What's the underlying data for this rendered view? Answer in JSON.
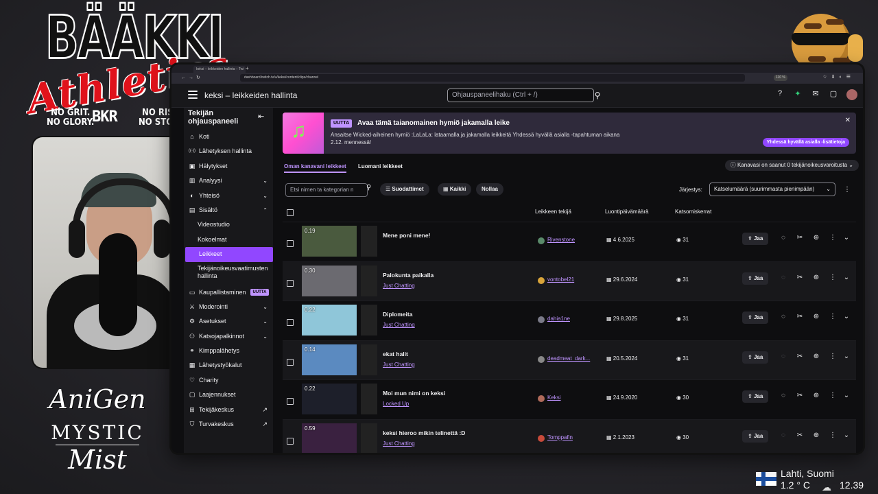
{
  "overlay": {
    "logo_main": "BÄÄKKI",
    "logo_script": "Athletics",
    "logo_tag_left": "NO GRIT.\nNO GLORY.",
    "logo_tag_right": "NO RISK.\nNO STORY.",
    "logo_mono": "BKR",
    "anigen_1": "AniGen",
    "anigen_2": "MYSTIC",
    "anigen_3": "Mist",
    "weather_city": "Lahti, Suomi",
    "weather_temp": "1.2 ° C",
    "clock": "12.39"
  },
  "browser": {
    "tab_title": "keksi – leikkeiden hallinta – Twi",
    "url": "dashboard.twitch.tv/u/keksi/content/clips/channel",
    "zoom": "110 %"
  },
  "topnav": {
    "title": "keksi – leikkeiden hallinta",
    "search_placeholder": "Ohjauspaneelihaku (Ctrl + /)"
  },
  "sidebar": {
    "heading": "Tekijän ohjauspaneeli",
    "items": [
      {
        "label": "Koti",
        "icon": "⌂"
      },
      {
        "label": "Lähetyksen hallinta",
        "icon": "((·))"
      },
      {
        "label": "Hälytykset",
        "icon": "▣"
      },
      {
        "label": "Analyysi",
        "icon": "▥",
        "chev": "⌄"
      },
      {
        "label": "Yhteisö",
        "icon": "◐",
        "chev": "⌄"
      },
      {
        "label": "Sisältö",
        "icon": "▤",
        "chev": "⌃"
      },
      {
        "label": "Videostudio"
      },
      {
        "label": "Kokoelmat"
      },
      {
        "label": "Leikkeet"
      },
      {
        "label": "Tekijänoikeusvaatimusten hallinta"
      },
      {
        "label": "Kaupallistaminen",
        "icon": "▭",
        "badge": "UUTTA"
      },
      {
        "label": "Moderointi",
        "icon": "⚔",
        "chev": "⌄"
      },
      {
        "label": "Asetukset",
        "icon": "⚙",
        "chev": "⌄"
      },
      {
        "label": "Katsojapalkinnot",
        "icon": "⚇",
        "chev": "⌄"
      },
      {
        "label": "Kimppalähetys",
        "icon": "⚭"
      },
      {
        "label": "Lähetystyökalut",
        "icon": "▦"
      },
      {
        "label": "Charity",
        "icon": "♡"
      },
      {
        "label": "Laajennukset",
        "icon": "▢"
      },
      {
        "label": "Tekijäkeskus",
        "icon": "⊞"
      },
      {
        "label": "Turvakeskus",
        "icon": "⛉"
      }
    ]
  },
  "banner": {
    "badge": "UUTTA",
    "title": "Avaa tämä taianomainen hymiö jakamalla leike",
    "description": "Ansaitse Wicked-aiheinen hymiö :LaLaLa: lataamalla ja jakamalla leikkeitä Yhdessä hyvällä asialla -tapahtuman aikana 2.12. mennessä!",
    "cta": "Yhdessä hyvällä asialla -lisätietoja",
    "close": "✕"
  },
  "tabs": [
    "Oman kanavani leikkeet",
    "Luomani leikkeet"
  ],
  "warning": "Kanavasi on saanut 0 tekijänoikeusvaroitusta",
  "filters": {
    "search_placeholder": "Etsi nimen ta kategorian n",
    "filters_label": "Suodattimet",
    "all_label": "Kaikki",
    "reset_label": "Nollaa",
    "sort_label": "Järjestys:",
    "sort_value": "Katselumäärä (suurimmasta pienimpään)"
  },
  "table": {
    "headers": {
      "author": "Leikkeen tekijä",
      "date": "Luontipäivämäärä",
      "views": "Katsomiskerrat"
    },
    "share_label": "Jaa",
    "rows": [
      {
        "duration": "0.19",
        "title": "Mene poni mene!",
        "category": "",
        "author": "Rivenstone",
        "date": "4.6.2025",
        "views": "31",
        "thumb": "#4a5a3e",
        "avatar": "#5a8a6a"
      },
      {
        "duration": "0.30",
        "title": "Palokunta paikalla",
        "category": "Just Chatting",
        "author": "vontobel21",
        "date": "29.6.2024",
        "views": "31",
        "thumb": "#6b6a70",
        "avatar": "#d9a43a"
      },
      {
        "duration": "0.22",
        "title": "Diplomeita",
        "category": "Just Chatting",
        "author": "dahia1ne",
        "date": "29.8.2025",
        "views": "31",
        "thumb": "#8fc6d9",
        "avatar": "#7a7a88"
      },
      {
        "duration": "0.14",
        "title": "ekat halit",
        "category": "Just Chatting",
        "author": "deadmeat_dark...",
        "date": "20.5.2024",
        "views": "31",
        "thumb": "#5b8ac0",
        "avatar": "#888"
      },
      {
        "duration": "0.22",
        "title": "Moi mun nimi on keksi",
        "category": "Locked Up",
        "author": "Keksi",
        "date": "24.9.2020",
        "views": "30",
        "thumb": "#1d1f2a",
        "avatar": "#b06a5a"
      },
      {
        "duration": "0.59",
        "title": "keksi hieroo mikin telinettä :D",
        "category": "Just Chatting",
        "author": "Tomppafin",
        "date": "2.1.2023",
        "views": "30",
        "thumb": "#3a2140",
        "avatar": "#c84a3a"
      }
    ]
  }
}
